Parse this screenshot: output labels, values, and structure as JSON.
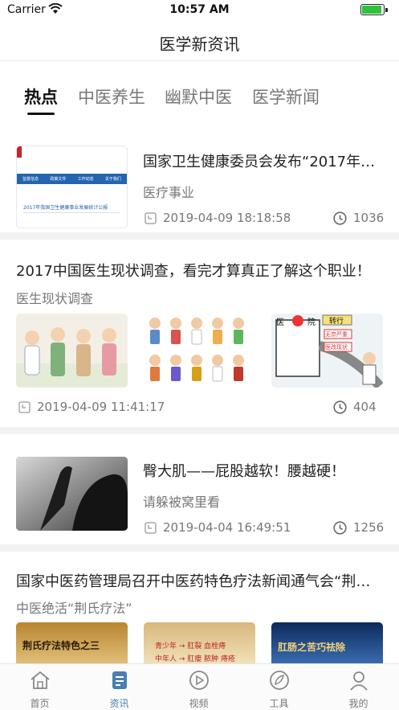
{
  "status": {
    "carrier": "Carrier",
    "time": "10:57 AM",
    "battery_level": 0.95
  },
  "nav": {
    "title": "医学新资讯"
  },
  "tabs": [
    {
      "label": "热点",
      "active": true
    },
    {
      "label": "中医养生",
      "active": false
    },
    {
      "label": "幽默中医",
      "active": false
    },
    {
      "label": "医学新闻",
      "active": false
    }
  ],
  "articles": [
    {
      "title": "国家卫生健康委员会发布“2017年…",
      "tag": "医疗事业",
      "date": "2019-04-09 18:18:58",
      "views": "1036",
      "thumb_caption": "2017年我国卫生健康事业发展统计公报",
      "thumb_menu": [
        "监督信息",
        "政策文件",
        "工作动态",
        "关于我们"
      ]
    },
    {
      "title": "2017中国医生现状调查，看完才算真正了解这个职业！",
      "tag": "医生现状调查",
      "date": "2019-04-09 11:41:17",
      "views": "404",
      "thumb3_labels": [
        "医",
        "院",
        "转行",
        "无奈严重",
        "医改现状"
      ]
    },
    {
      "title": "臀大肌——屁股越软！腰越硬！",
      "tag": "请躲被窝里看",
      "date": "2019-04-04 16:49:51",
      "views": "1256"
    },
    {
      "title": "国家中医药管理局召开中医药特色疗法新闻通气会“荆…",
      "tag": "中医绝活“荆氏疗法”",
      "thumb_texts": [
        "荆氏疗法特色之三",
        "青少年 → 肛裂 血栓痔",
        "中年人 → 肛瘘 脓肿 痔疮",
        "肛肠之苦巧祛除"
      ]
    }
  ],
  "tabbar": [
    {
      "label": "首页",
      "icon": "home-icon",
      "active": false
    },
    {
      "label": "资讯",
      "icon": "news-icon",
      "active": true
    },
    {
      "label": "视频",
      "icon": "video-icon",
      "active": false
    },
    {
      "label": "工具",
      "icon": "tools-icon",
      "active": false
    },
    {
      "label": "我的",
      "icon": "profile-icon",
      "active": false
    }
  ],
  "colors": {
    "accent": "#4a7fb0",
    "battery": "#2ec23b",
    "separator": "#f2f2f2"
  }
}
